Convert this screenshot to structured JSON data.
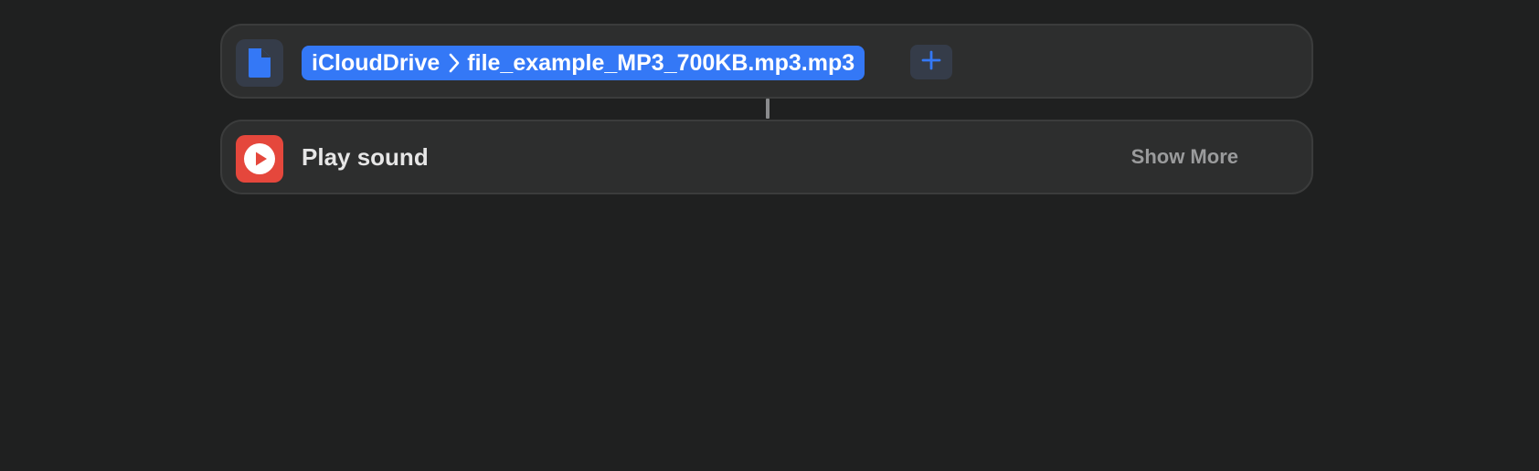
{
  "file_action": {
    "icon": "document-icon",
    "path_location": "iCloudDrive",
    "path_separator_icon": "chevron-right-icon",
    "path_filename": "file_example_MP3_700KB.mp3.mp3",
    "add_icon": "plus-icon"
  },
  "play_action": {
    "icon": "play-circle-icon",
    "title": "Play sound",
    "show_more_label": "Show More"
  },
  "colors": {
    "background": "#1f2020",
    "card": "#2d2e2e",
    "accent": "#3478f6",
    "play_icon": "#e5473c",
    "connector": "#8a8b8d"
  }
}
